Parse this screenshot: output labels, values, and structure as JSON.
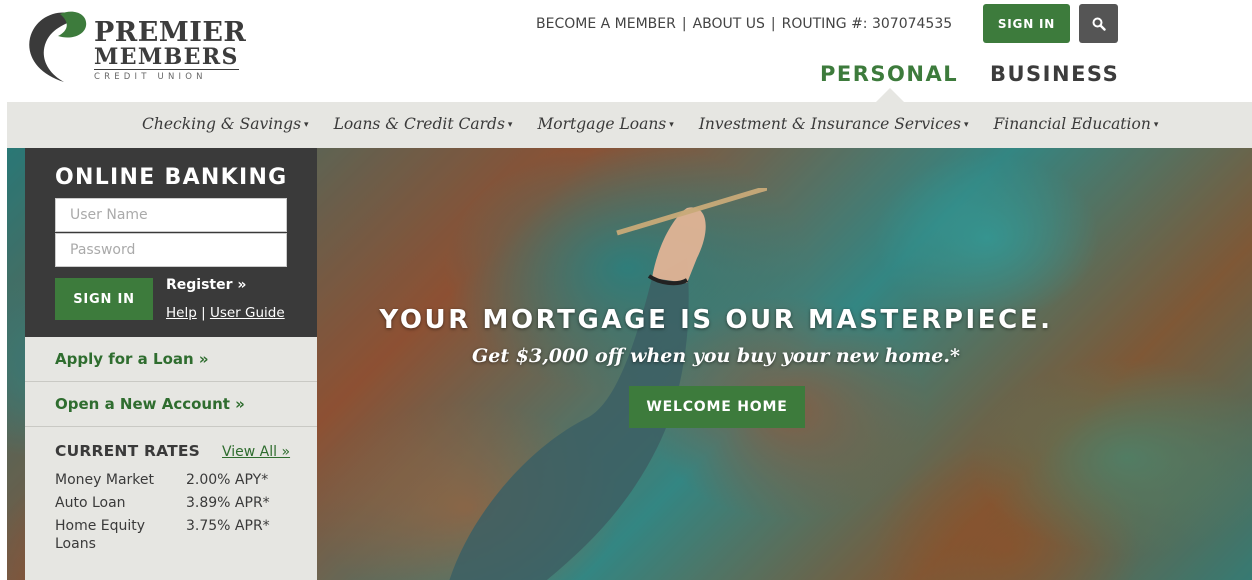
{
  "brand": {
    "line1": "PREMIER",
    "line2": "MEMBERS",
    "line3": "CREDIT UNION",
    "logo_icon": "swirl-logo-icon",
    "colors": {
      "green": "#3d7b3c",
      "dark": "#3a3a3a",
      "nav_bg": "#e6e6e2"
    }
  },
  "utility_nav": {
    "become_member": "BECOME A MEMBER",
    "about_us": "ABOUT US",
    "routing": "ROUTING #: 307074535",
    "separator": "|",
    "signin_label": "SIGN IN",
    "search_icon": "search-icon"
  },
  "segments": {
    "personal": "PERSONAL",
    "business": "BUSINESS"
  },
  "main_nav": {
    "items": [
      {
        "label": "Checking & Savings"
      },
      {
        "label": "Loans & Credit Cards"
      },
      {
        "label": "Mortgage Loans"
      },
      {
        "label": "Investment & Insurance Services"
      },
      {
        "label": "Financial Education"
      }
    ],
    "caret": "▾"
  },
  "online_banking": {
    "title": "ONLINE BANKING",
    "username_placeholder": "User Name",
    "password_placeholder": "Password",
    "signin_label": "SIGN IN",
    "register": "Register »",
    "help": "Help",
    "help_sep": "|",
    "user_guide": "User Guide"
  },
  "sidebar_links": {
    "apply": "Apply for a Loan »",
    "open_account": "Open a New Account »"
  },
  "rates": {
    "title": "CURRENT RATES",
    "view_all": "View All »",
    "rows": [
      {
        "label": "Money Market",
        "value": "2.00% APY*"
      },
      {
        "label": "Auto Loan",
        "value": "3.89% APR*"
      },
      {
        "label": "Home Equity Loans",
        "value": "3.75% APR*"
      }
    ]
  },
  "hero": {
    "headline": "YOUR MORTGAGE IS OUR MASTERPIECE.",
    "subline": "Get $3,000 off when you buy your new home.*",
    "cta": "WELCOME HOME"
  }
}
